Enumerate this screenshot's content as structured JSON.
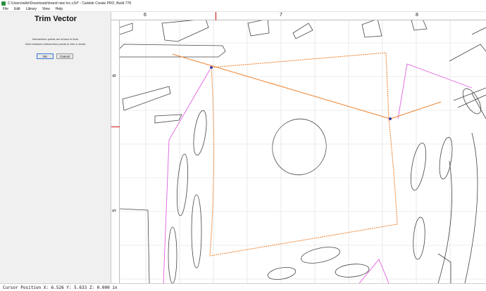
{
  "window": {
    "title": "C:\\Users\\willz\\Downloads\\brand new hrc.c2d* - Carbide Create PRO, Build 778"
  },
  "menu": {
    "items": [
      {
        "label": "File"
      },
      {
        "label": "Edit"
      },
      {
        "label": "Library"
      },
      {
        "label": "View"
      },
      {
        "label": "Help"
      }
    ]
  },
  "panel": {
    "title": "Trim Vector",
    "line1": "Intersection points are shown in blue.",
    "line2": "Click between intersection points to trim a vector.",
    "ok_label": "OK",
    "cancel_label": "Cancel"
  },
  "ruler": {
    "top_labels": [
      "6",
      "7",
      "8"
    ],
    "left_labels": [
      "6",
      "5"
    ]
  },
  "status": {
    "cursor_text": "Cursor Position X: 6.526 Y: 5.633 Z: 0.000 in"
  },
  "colors": {
    "selected_vector": "#f08a3a",
    "magenta_vector": "#e060e0",
    "intersection_point": "#3d3da8",
    "grid": "#dcdcdc",
    "shape_stroke": "#444444",
    "ruler_marker": "#d01010"
  }
}
